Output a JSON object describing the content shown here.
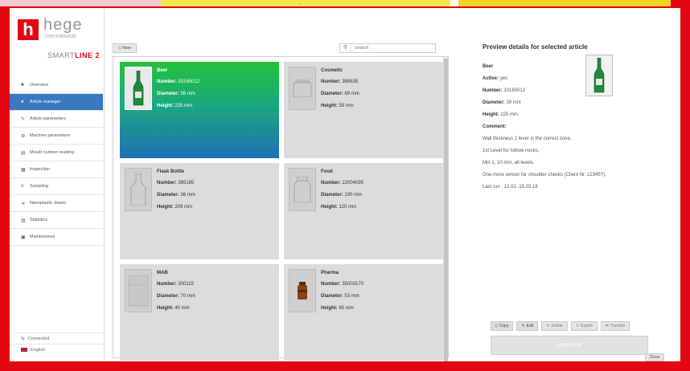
{
  "topbar": {
    "center_label": "..."
  },
  "logo": {
    "name": "hege",
    "tagline": "international",
    "product_prefix": "SMART",
    "product_suffix": "LINE 2"
  },
  "sidebar": {
    "items": [
      {
        "label": "Overview",
        "icon": "home-icon",
        "active": false
      },
      {
        "label": "Article manager",
        "icon": "user-icon",
        "active": true
      },
      {
        "label": "Article parameters",
        "icon": "wrench-icon",
        "active": false
      },
      {
        "label": "Machine parameters",
        "icon": "gear-icon",
        "active": false
      },
      {
        "label": "Mould number reading",
        "icon": "book-icon",
        "active": false
      },
      {
        "label": "Inspection",
        "icon": "grid-icon",
        "active": false
      },
      {
        "label": "Sampling",
        "icon": "list-icon",
        "active": false
      },
      {
        "label": "Nanoplastic doses",
        "icon": "arrow-icon",
        "active": false
      },
      {
        "label": "Statistics",
        "icon": "chart-icon",
        "active": false
      },
      {
        "label": "Maintenance",
        "icon": "tools-icon",
        "active": false
      }
    ],
    "footer": {
      "connection": "Connected",
      "language": "English"
    }
  },
  "toolbar": {
    "new_label": "New",
    "search_placeholder": "Search"
  },
  "articles": [
    {
      "title": "Beer",
      "number_label": "Number:",
      "number": "33165012",
      "diameter_label": "Diameter:",
      "diameter": "38 mm",
      "height_label": "Height:",
      "height": "225 mm",
      "selected": true,
      "shape": "green-bottle"
    },
    {
      "title": "Cosmetic",
      "number_label": "Number:",
      "number": "368635",
      "diameter_label": "Diameter:",
      "diameter": "69 mm",
      "height_label": "Height:",
      "height": "59 mm",
      "selected": false,
      "shape": "jar"
    },
    {
      "title": "Flask Bottle",
      "number_label": "Number:",
      "number": "365185",
      "diameter_label": "Diameter:",
      "diameter": "36 mm",
      "height_label": "Height:",
      "height": "209 mm",
      "selected": false,
      "shape": "flask"
    },
    {
      "title": "Food",
      "number_label": "Number:",
      "number": "22004095",
      "diameter_label": "Diameter:",
      "diameter": "100 mm",
      "height_label": "Height:",
      "height": "120 mm",
      "selected": false,
      "shape": "food-jar"
    },
    {
      "title": "MAB",
      "number_label": "Number:",
      "number": "300115",
      "diameter_label": "Diameter:",
      "diameter": "70 mm",
      "height_label": "Height:",
      "height": "40 mm",
      "selected": false,
      "shape": "low-jar"
    },
    {
      "title": "Pharma",
      "number_label": "Number:",
      "number": "35003170",
      "diameter_label": "Diameter:",
      "diameter": "53 mm",
      "height_label": "Height:",
      "height": "65 mm",
      "selected": false,
      "shape": "amber-bottle"
    }
  ],
  "preview": {
    "title": "Preview details for selected article",
    "name_label": "Beer",
    "active_label": "Active:",
    "active_value": "yes",
    "number_label": "Number:",
    "number_value": "33165012",
    "diameter_label": "Diameter:",
    "diameter_value": "38 mm",
    "height_label": "Height:",
    "height_value": "225 mm",
    "comment_label": "Comment:",
    "comment_lines": [
      "Wall thickness 1 lever in the correct zone,",
      "1st Level for hollow necks,",
      "Min 1, 10 mm, all levels.",
      "One more sensor for shoulder checks (Client Nr. 12345?).",
      "Last run : 12.02.-15.03.18"
    ],
    "actions": {
      "copy": "Copy",
      "edit": "Edit",
      "delete": "Delete",
      "export": "Export",
      "transfer": "Transfer"
    },
    "apply_label": "Load article",
    "close_label": "Close"
  }
}
